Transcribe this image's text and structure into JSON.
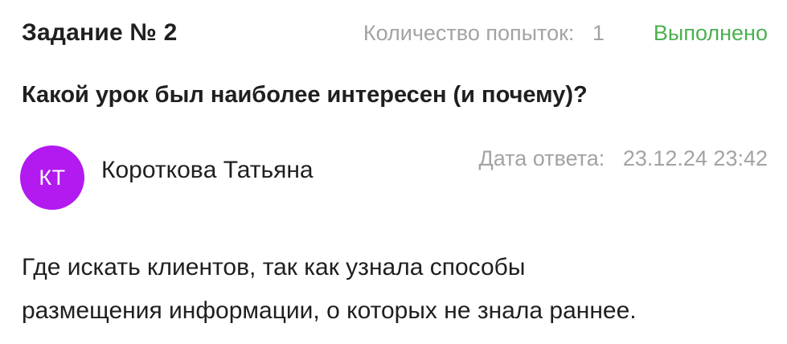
{
  "task": {
    "title": "Задание № 2",
    "attempts_label": "Количество попыток:",
    "attempts_count": "1",
    "status": "Выполнено",
    "question": "Какой урок был наиболее интересен (и почему)?"
  },
  "answer": {
    "avatar_initials": "КТ",
    "author_name": "Коротковa Татьяна",
    "date_label": "Дата ответа:",
    "date_value": "23.12.24 23:42",
    "text_lines": [
      "Где искать клиентов, так как узнала способы",
      "размещения информации, о которых не знала раннее."
    ]
  },
  "colors": {
    "status_done": "#4cb04f",
    "avatar_bg": "#b21af0",
    "muted_text": "#a3a3a3",
    "primary_text": "#1f1f1f"
  }
}
